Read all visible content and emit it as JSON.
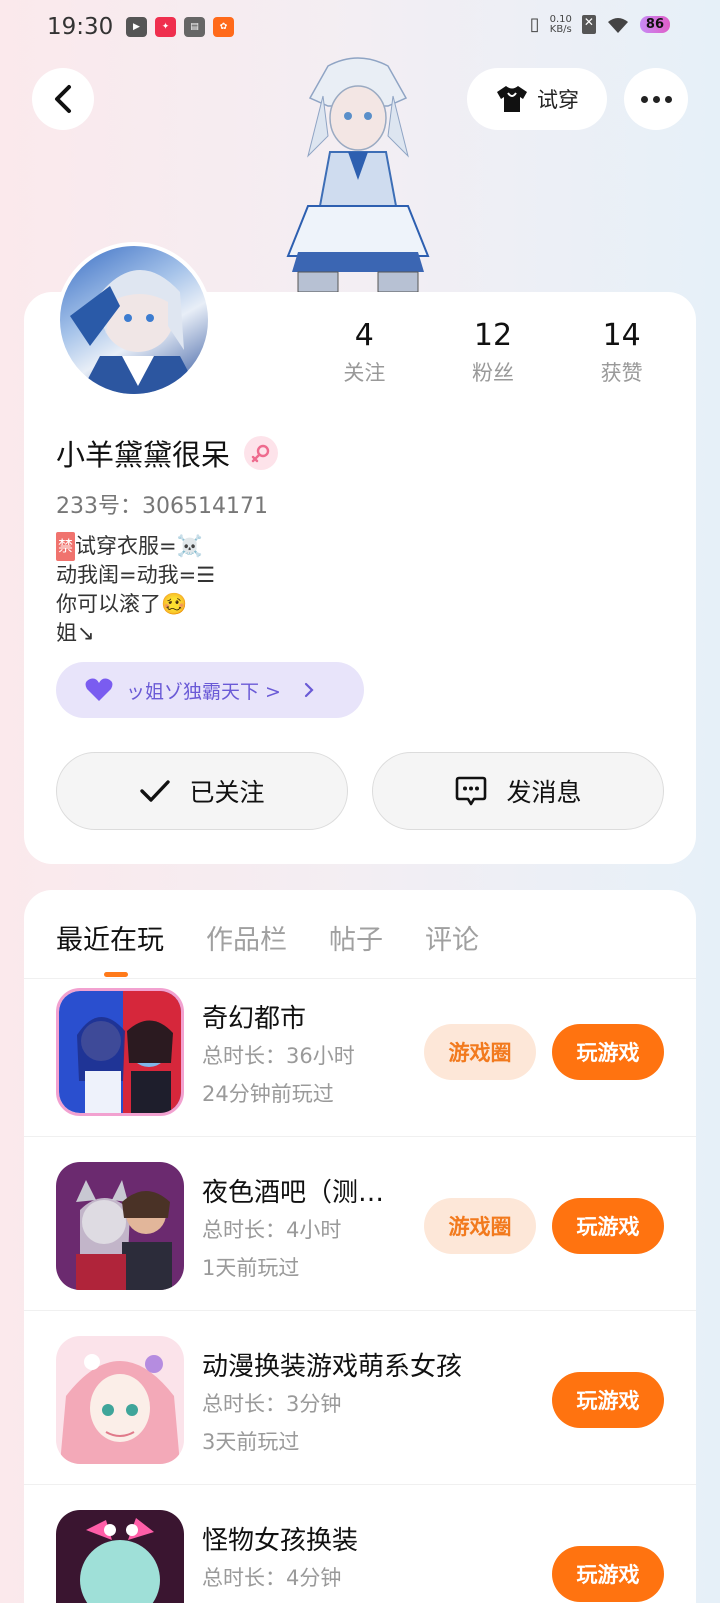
{
  "status_bar": {
    "time": "19:30",
    "net_speed_value": "0.10",
    "net_speed_unit": "KB/s",
    "battery": "86"
  },
  "header": {
    "tryon_label": "试穿"
  },
  "profile": {
    "username": "小羊黛黛很呆",
    "uid": "233号：306514171",
    "bio_ban_tag": "禁",
    "bio_line1": "试穿衣服=☠️",
    "bio_line2": "动我闺=动我=☰",
    "bio_line3": "你可以滚了🥴",
    "bio_line4": "姐↘",
    "stats": [
      {
        "num": "4",
        "label": "关注"
      },
      {
        "num": "12",
        "label": "粉丝"
      },
      {
        "num": "14",
        "label": "获赞"
      }
    ],
    "guild": "ッ姐ゾ独霸天下 >",
    "follow_label": "已关注",
    "message_label": "发消息"
  },
  "tabs": [
    "最近在玩",
    "作品栏",
    "帖子",
    "评论"
  ],
  "games": [
    {
      "name": "奇幻都市",
      "time": "总时长：36小时",
      "last": "24分钟前玩过",
      "circle": "游戏圈",
      "play": "玩游戏"
    },
    {
      "name": "夜色酒吧（测…",
      "time": "总时长：4小时",
      "last": "1天前玩过",
      "circle": "游戏圈",
      "play": "玩游戏"
    },
    {
      "name": "动漫换装游戏萌系女孩",
      "time": "总时长：3分钟",
      "last": "3天前玩过",
      "play": "玩游戏"
    },
    {
      "name": "怪物女孩换装",
      "time": "总时长：4分钟",
      "last": "",
      "play": "玩游戏"
    }
  ],
  "colors": {
    "accent": "#ff7310",
    "accent_soft": "#fde7d8",
    "guild_text": "#6a5ad6"
  }
}
